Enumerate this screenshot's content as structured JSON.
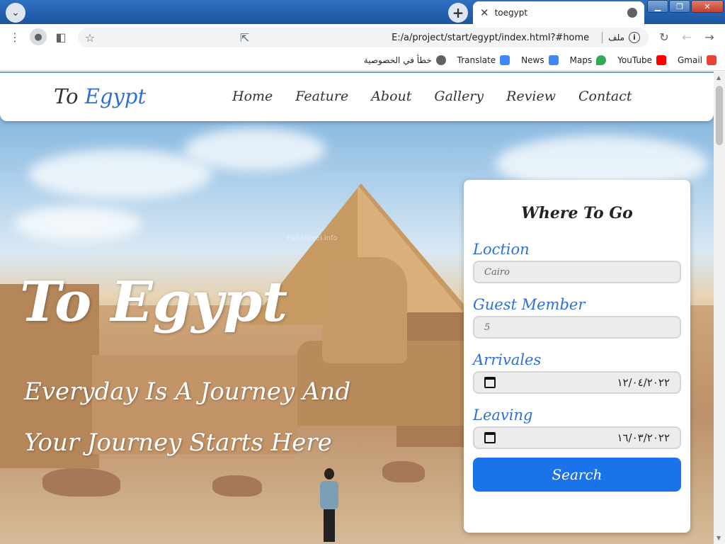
{
  "browser": {
    "tab_title": "toegypt",
    "url": "E:/a/project/start/egypt/index.html?#home",
    "url_prefix": "ملف",
    "bookmarks": [
      {
        "label": "Gmail",
        "icon": "gmail-icon",
        "color": "#ea4335"
      },
      {
        "label": "YouTube",
        "icon": "youtube-icon",
        "color": "#ff0000"
      },
      {
        "label": "Maps",
        "icon": "maps-icon",
        "color": "#34a853"
      },
      {
        "label": "News",
        "icon": "news-icon",
        "color": "#4285f4"
      },
      {
        "label": "Translate",
        "icon": "translate-icon",
        "color": "#4285f4"
      },
      {
        "label": "خطأ في الخصوصية",
        "icon": "globe-icon",
        "color": "#5f6368"
      }
    ]
  },
  "nav": {
    "logo_part1": "To",
    "logo_part2": "Egypt",
    "items": [
      "Home",
      "Feature",
      "About",
      "Gallery",
      "Review",
      "Contact"
    ]
  },
  "hero": {
    "title": "To Egypt",
    "subtitle": "Everyday Is A Journey And Your Journey Starts Here",
    "watermark": "Full-travel.info"
  },
  "booking": {
    "title": "Where To Go",
    "location_label": "Loction",
    "location_placeholder": "Cairo",
    "guest_label": "Guest Member",
    "guest_placeholder": "5",
    "arrival_label": "Arrivales",
    "arrival_value": "١٢/٠٤/٢٠٢٢",
    "leaving_label": "Leaving",
    "leaving_value": "١٦/٠٣/٢٠٢٢",
    "search_label": "Search"
  },
  "colors": {
    "accent": "#1a73e8",
    "logo_blue": "#2e6fd8",
    "titlebar": "#1f5fa8"
  }
}
